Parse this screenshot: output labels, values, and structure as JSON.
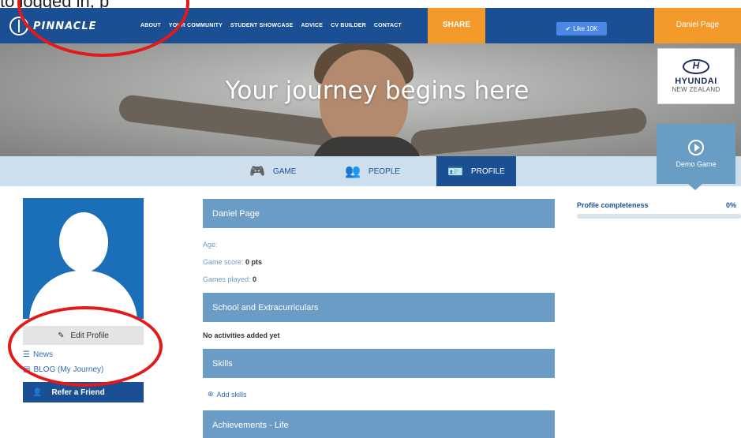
{
  "top_strip": {
    "partial_text": "to logged in, p"
  },
  "navbar": {
    "logo_text": "PINNACLE",
    "links": [
      "ABOUT",
      "YOUR COMMUNITY",
      "STUDENT SHOWCASE",
      "ADVICE",
      "CV BUILDER",
      "CONTACT"
    ],
    "share_label": "SHARE",
    "like_label": "Like 10K",
    "user_name": "Daniel Page",
    "colors": {
      "navy": "#1b4f93",
      "orange": "#f39a2b"
    }
  },
  "hero": {
    "title": "Your journey begins here",
    "sponsor": {
      "brand": "HYUNDAI",
      "region": "NEW ZEALAND"
    }
  },
  "tabs": [
    {
      "label": "GAME",
      "icon": "gamepad-icon"
    },
    {
      "label": "PEOPLE",
      "icon": "people-icon"
    },
    {
      "label": "PROFILE",
      "icon": "id-card-icon",
      "active": true
    }
  ],
  "demo": {
    "label": "Demo Game",
    "icon": "play-icon"
  },
  "sidebar": {
    "edit_profile": "Edit Profile",
    "links": [
      {
        "label": "News",
        "icon": "list-icon"
      },
      {
        "label": "BLOG (My Journey)",
        "icon": "blog-icon"
      }
    ],
    "refer_label": "Refer a Friend"
  },
  "profile": {
    "name": "Daniel Page",
    "age_label": "Age:",
    "age_value": "",
    "score_label": "Game score:",
    "score_value": "0 pts",
    "games_label": "Games played:",
    "games_value": "0",
    "sections": {
      "school": "School and Extracurriculars",
      "school_empty": "No activities added yet",
      "skills": "Skills",
      "add_skills": "Add skills",
      "achievements": "Achievements - Life"
    }
  },
  "completeness": {
    "label": "Profile completeness",
    "value_text": "0%",
    "fraction": 0.0
  }
}
